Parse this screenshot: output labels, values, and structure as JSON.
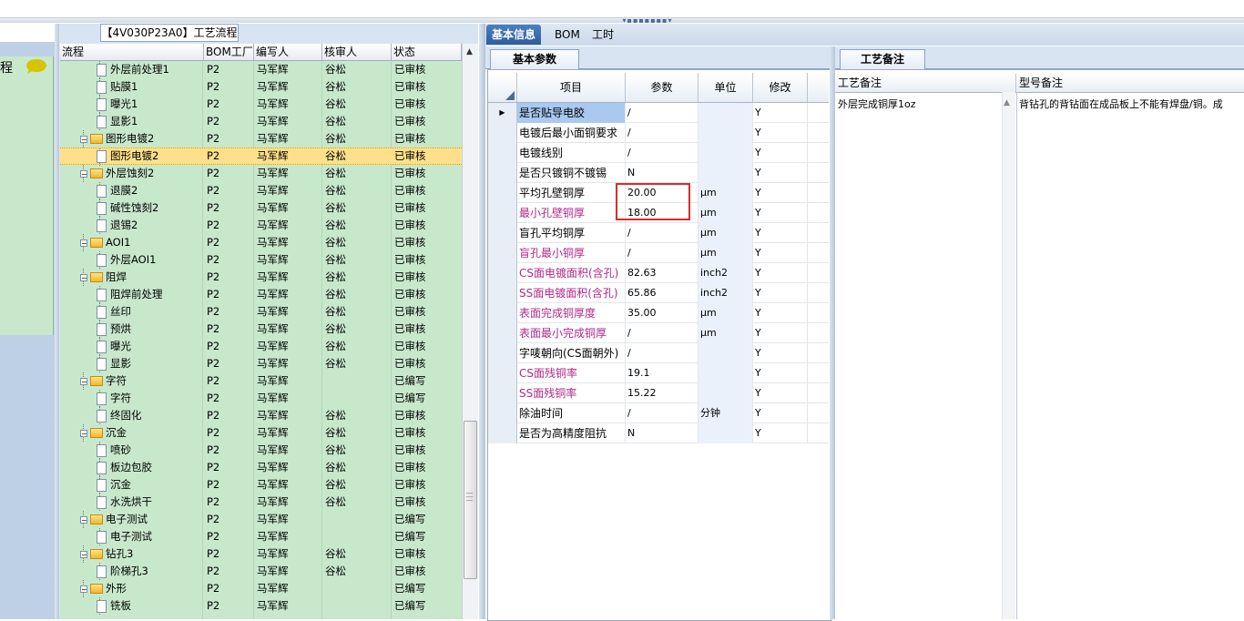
{
  "flow_panel": {
    "title": "【4V030P23A0】工艺流程",
    "headers": {
      "flow": "流程",
      "bom": "BOM工厂",
      "writer": "编写人",
      "reviewer": "核审人",
      "status": "状态"
    },
    "rows": [
      {
        "name": "外层前处理1",
        "bom": "P2",
        "writer": "马军辉",
        "reviewer": "谷松",
        "status": "已审核",
        "kind": "leaf"
      },
      {
        "name": "贴膜1",
        "bom": "P2",
        "writer": "马军辉",
        "reviewer": "谷松",
        "status": "已审核",
        "kind": "leaf"
      },
      {
        "name": "曝光1",
        "bom": "P2",
        "writer": "马军辉",
        "reviewer": "谷松",
        "status": "已审核",
        "kind": "leaf"
      },
      {
        "name": "显影1",
        "bom": "P2",
        "writer": "马军辉",
        "reviewer": "谷松",
        "status": "已审核",
        "kind": "leaf"
      },
      {
        "name": "图形电镀2",
        "bom": "P2",
        "writer": "马军辉",
        "reviewer": "谷松",
        "status": "已审核",
        "kind": "group"
      },
      {
        "name": "图形电镀2",
        "bom": "P2",
        "writer": "马军辉",
        "reviewer": "谷松",
        "status": "已审核",
        "kind": "leaf",
        "selected": true
      },
      {
        "name": "外层蚀刻2",
        "bom": "P2",
        "writer": "马军辉",
        "reviewer": "谷松",
        "status": "已审核",
        "kind": "group"
      },
      {
        "name": "退膜2",
        "bom": "P2",
        "writer": "马军辉",
        "reviewer": "谷松",
        "status": "已审核",
        "kind": "leaf"
      },
      {
        "name": "碱性蚀刻2",
        "bom": "P2",
        "writer": "马军辉",
        "reviewer": "谷松",
        "status": "已审核",
        "kind": "leaf"
      },
      {
        "name": "退锡2",
        "bom": "P2",
        "writer": "马军辉",
        "reviewer": "谷松",
        "status": "已审核",
        "kind": "leaf"
      },
      {
        "name": "AOI1",
        "bom": "P2",
        "writer": "马军辉",
        "reviewer": "谷松",
        "status": "已审核",
        "kind": "group"
      },
      {
        "name": "外层AOI1",
        "bom": "P2",
        "writer": "马军辉",
        "reviewer": "谷松",
        "status": "已审核",
        "kind": "leaf"
      },
      {
        "name": "阻焊",
        "bom": "P2",
        "writer": "马军辉",
        "reviewer": "谷松",
        "status": "已审核",
        "kind": "group"
      },
      {
        "name": "阻焊前处理",
        "bom": "P2",
        "writer": "马军辉",
        "reviewer": "谷松",
        "status": "已审核",
        "kind": "leaf"
      },
      {
        "name": "丝印",
        "bom": "P2",
        "writer": "马军辉",
        "reviewer": "谷松",
        "status": "已审核",
        "kind": "leaf"
      },
      {
        "name": "预烘",
        "bom": "P2",
        "writer": "马军辉",
        "reviewer": "谷松",
        "status": "已审核",
        "kind": "leaf"
      },
      {
        "name": "曝光",
        "bom": "P2",
        "writer": "马军辉",
        "reviewer": "谷松",
        "status": "已审核",
        "kind": "leaf"
      },
      {
        "name": "显影",
        "bom": "P2",
        "writer": "马军辉",
        "reviewer": "谷松",
        "status": "已审核",
        "kind": "leaf"
      },
      {
        "name": "字符",
        "bom": "P2",
        "writer": "马军辉",
        "reviewer": "",
        "status": "已编写",
        "kind": "group"
      },
      {
        "name": "字符",
        "bom": "P2",
        "writer": "马军辉",
        "reviewer": "",
        "status": "已编写",
        "kind": "leaf"
      },
      {
        "name": "终固化",
        "bom": "P2",
        "writer": "马军辉",
        "reviewer": "谷松",
        "status": "已审核",
        "kind": "leaf"
      },
      {
        "name": "沉金",
        "bom": "P2",
        "writer": "马军辉",
        "reviewer": "谷松",
        "status": "已审核",
        "kind": "group"
      },
      {
        "name": "喷砂",
        "bom": "P2",
        "writer": "马军辉",
        "reviewer": "谷松",
        "status": "已审核",
        "kind": "leaf"
      },
      {
        "name": "板边包胶",
        "bom": "P2",
        "writer": "马军辉",
        "reviewer": "谷松",
        "status": "已审核",
        "kind": "leaf"
      },
      {
        "name": "沉金",
        "bom": "P2",
        "writer": "马军辉",
        "reviewer": "谷松",
        "status": "已审核",
        "kind": "leaf"
      },
      {
        "name": "水洗烘干",
        "bom": "P2",
        "writer": "马军辉",
        "reviewer": "谷松",
        "status": "已审核",
        "kind": "leaf"
      },
      {
        "name": "电子测试",
        "bom": "P2",
        "writer": "马军辉",
        "reviewer": "",
        "status": "已编写",
        "kind": "group"
      },
      {
        "name": "电子测试",
        "bom": "P2",
        "writer": "马军辉",
        "reviewer": "",
        "status": "已编写",
        "kind": "leaf"
      },
      {
        "name": "钻孔3",
        "bom": "P2",
        "writer": "马军辉",
        "reviewer": "谷松",
        "status": "已审核",
        "kind": "group"
      },
      {
        "name": "阶梯孔3",
        "bom": "P2",
        "writer": "马军辉",
        "reviewer": "谷松",
        "status": "已审核",
        "kind": "leaf"
      },
      {
        "name": "外形",
        "bom": "P2",
        "writer": "马军辉",
        "reviewer": "",
        "status": "已编写",
        "kind": "group"
      },
      {
        "name": "铣板",
        "bom": "P2",
        "writer": "马军辉",
        "reviewer": "",
        "status": "已编写",
        "kind": "leaf"
      }
    ]
  },
  "left_panel": {
    "label": "程"
  },
  "main_tabs": [
    {
      "label": "基本信息",
      "active": true
    },
    {
      "label": "BOM",
      "active": false
    },
    {
      "label": "工时",
      "active": false
    }
  ],
  "params_panel": {
    "tab": "基本参数",
    "headers": {
      "item": "项目",
      "value": "参数",
      "unit": "单位",
      "modify": "修改"
    },
    "rows": [
      {
        "item": "是否贴导电胶",
        "value": "/",
        "unit": "",
        "mod": "Y",
        "pink": false,
        "current": true
      },
      {
        "item": "电镀后最小面铜要求",
        "value": "/",
        "unit": "",
        "mod": "Y",
        "pink": false
      },
      {
        "item": "电镀线别",
        "value": "/",
        "unit": "",
        "mod": "Y",
        "pink": false
      },
      {
        "item": "是否只镀铜不镀锡",
        "value": "N",
        "unit": "",
        "mod": "Y",
        "pink": false
      },
      {
        "item": "平均孔壁铜厚",
        "value": "20.00",
        "unit": "μm",
        "mod": "Y",
        "pink": false
      },
      {
        "item": "最小孔壁铜厚",
        "value": "18.00",
        "unit": "μm",
        "mod": "Y",
        "pink": true
      },
      {
        "item": "盲孔平均铜厚",
        "value": "/",
        "unit": "μm",
        "mod": "Y",
        "pink": false
      },
      {
        "item": "盲孔最小铜厚",
        "value": "/",
        "unit": "μm",
        "mod": "Y",
        "pink": true
      },
      {
        "item": "CS面电镀面积(含孔)",
        "value": "82.63",
        "unit": "inch2",
        "mod": "Y",
        "pink": true
      },
      {
        "item": "SS面电镀面积(含孔)",
        "value": "65.86",
        "unit": "inch2",
        "mod": "Y",
        "pink": true
      },
      {
        "item": "表面完成铜厚度",
        "value": "35.00",
        "unit": "μm",
        "mod": "Y",
        "pink": true
      },
      {
        "item": "表面最小完成铜厚",
        "value": "/",
        "unit": "μm",
        "mod": "Y",
        "pink": true
      },
      {
        "item": "字唛朝向(CS面朝外)",
        "value": "/",
        "unit": "",
        "mod": "Y",
        "pink": false
      },
      {
        "item": "CS面残铜率",
        "value": "19.1",
        "unit": "",
        "mod": "Y",
        "pink": true
      },
      {
        "item": "SS面残铜率",
        "value": "15.22",
        "unit": "",
        "mod": "Y",
        "pink": true
      },
      {
        "item": "除油时间",
        "value": "/",
        "unit": "分钟",
        "mod": "Y",
        "pink": false
      },
      {
        "item": "是否为高精度阻抗",
        "value": "N",
        "unit": "",
        "mod": "Y",
        "pink": false
      }
    ]
  },
  "notes_panel": {
    "tab": "工艺备注",
    "headers": {
      "process_note": "工艺备注",
      "model_note": "型号备注"
    },
    "process_note": "外层完成铜厚1oz",
    "model_note": "背钻孔的背钻面在成品板上不能有焊盘/铜。成"
  },
  "colors": {
    "accent": "#2d5c9e",
    "grid_green": "#c8e8cc",
    "selected_row": "#ffe08a",
    "highlight_box": "#d92b2b",
    "pink_text": "#b0288a"
  }
}
